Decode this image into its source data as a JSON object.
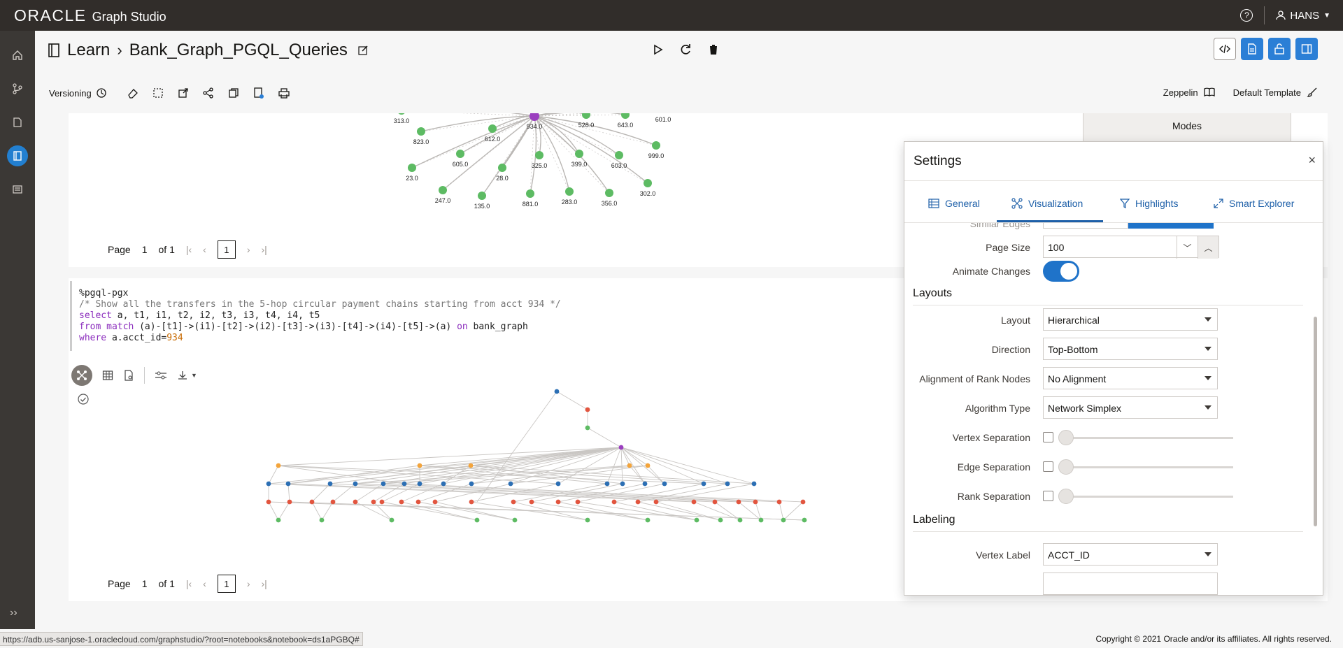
{
  "app": {
    "brand": "ORACLE",
    "product": "Graph Studio",
    "user": "HANS"
  },
  "breadcrumb": {
    "root": "Learn",
    "notebook": "Bank_Graph_PGQL_Queries"
  },
  "toolbar": {
    "versioning_label": "Versioning",
    "zeppelin_label": "Zeppelin",
    "template_label": "Default Template"
  },
  "paragraph1": {
    "graph_nodes": [
      "313.0",
      "934.0",
      "528.0",
      "643.0",
      "601.0",
      "823.0",
      "612.0",
      "999.0",
      "605.0",
      "325.0",
      "399.0",
      "603.0",
      "23.0",
      "28.0",
      "302.0",
      "247.0",
      "135.0",
      "881.0",
      "283.0",
      "356.0"
    ],
    "pager": {
      "page_label": "Page",
      "current": "1",
      "of_label": "of 1",
      "box": "1"
    }
  },
  "paragraph2": {
    "code_lines": [
      "%pgql-pgx",
      "/* Show all the transfers in the 5-hop circular payment chains starting from acct 934 */",
      "select a, t1, i1, t2, i2, t3, i3, t4, i4, t5",
      "from match (a)-[t1]->(i1)-[t2]->(i2)-[t3]->(i3)-[t4]->(i4)-[t5]->(a) on bank_graph",
      "where a.acct_id=934"
    ],
    "pager": {
      "page_label": "Page",
      "current": "1",
      "of_label": "of 1",
      "box": "1"
    }
  },
  "modes_panel": {
    "title": "Modes"
  },
  "settings": {
    "title": "Settings",
    "close": "×",
    "tabs": [
      {
        "label": "General",
        "icon": "table-icon"
      },
      {
        "label": "Visualization",
        "icon": "graph-icon"
      },
      {
        "label": "Highlights",
        "icon": "filter-icon"
      },
      {
        "label": "Smart Explorer",
        "icon": "expand-icon"
      }
    ],
    "similar_edges_label": "Similar Edges",
    "page_size": {
      "label": "Page Size",
      "value": "100"
    },
    "animate_changes": {
      "label": "Animate Changes",
      "on": true
    },
    "layouts_section": "Layouts",
    "layout": {
      "label": "Layout",
      "value": "Hierarchical"
    },
    "direction": {
      "label": "Direction",
      "value": "Top-Bottom"
    },
    "alignment": {
      "label": "Alignment of Rank Nodes",
      "value": "No Alignment"
    },
    "algorithm": {
      "label": "Algorithm Type",
      "value": "Network Simplex"
    },
    "vertex_sep": {
      "label": "Vertex Separation"
    },
    "edge_sep": {
      "label": "Edge Separation"
    },
    "rank_sep": {
      "label": "Rank Separation"
    },
    "labeling_section": "Labeling",
    "vertex_label": {
      "label": "Vertex Label",
      "value": "ACCT_ID"
    }
  },
  "footer": {
    "status_url": "https://adb.us-sanjose-1.oraclecloud.com/graphstudio/?root=notebooks&notebook=ds1aPGBQ#",
    "copyright": "Copyright © 2021 Oracle and/or its affiliates. All rights reserved."
  },
  "colors": {
    "topbar": "#312d2a",
    "accent": "#227fd0",
    "node_green": "#5dbb63",
    "node_purple": "#9b3fbf",
    "node_blue": "#2c6fb4",
    "node_orange": "#f3a43b",
    "node_red": "#e2553f"
  }
}
